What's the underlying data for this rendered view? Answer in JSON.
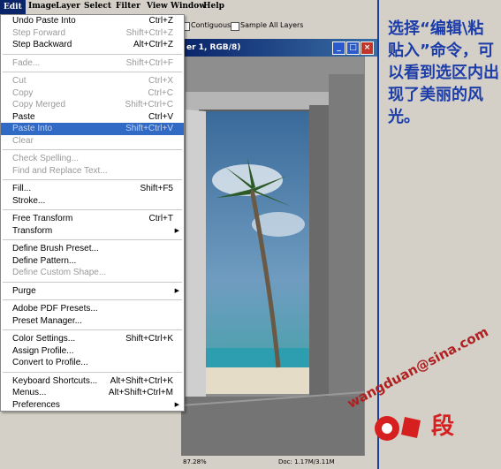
{
  "menubar": {
    "items": [
      "Edit",
      "Image",
      "Layer",
      "Select",
      "Filter",
      "View",
      "Window",
      "Help"
    ]
  },
  "options": {
    "contiguous": "Contiguous",
    "sample_all": "Sample All Layers"
  },
  "document": {
    "title": "er 1, RGB/8)",
    "zoom": "87.28%",
    "doc_info": "Doc: 1.17M/3.11M"
  },
  "edit_menu": {
    "items": [
      {
        "label": "Undo Paste Into",
        "shortcut": "Ctrl+Z"
      },
      {
        "label": "Step Forward",
        "shortcut": "Shift+Ctrl+Z",
        "disabled": true
      },
      {
        "label": "Step Backward",
        "shortcut": "Alt+Ctrl+Z"
      },
      {
        "label": "Fade...",
        "shortcut": "Shift+Ctrl+F",
        "disabled": true
      },
      {
        "label": "Cut",
        "shortcut": "Ctrl+X",
        "disabled": true
      },
      {
        "label": "Copy",
        "shortcut": "Ctrl+C",
        "disabled": true
      },
      {
        "label": "Copy Merged",
        "shortcut": "Shift+Ctrl+C",
        "disabled": true
      },
      {
        "label": "Paste",
        "shortcut": "Ctrl+V"
      },
      {
        "label": "Paste Into",
        "shortcut": "Shift+Ctrl+V",
        "disabled": true,
        "highlighted": true
      },
      {
        "label": "Clear",
        "shortcut": "",
        "disabled": true
      },
      {
        "label": "Check Spelling...",
        "shortcut": "",
        "disabled": true
      },
      {
        "label": "Find and Replace Text...",
        "shortcut": "",
        "disabled": true
      },
      {
        "label": "Fill...",
        "shortcut": "Shift+F5"
      },
      {
        "label": "Stroke...",
        "shortcut": ""
      },
      {
        "label": "Free Transform",
        "shortcut": "Ctrl+T"
      },
      {
        "label": "Transform",
        "shortcut": "",
        "submenu": true
      },
      {
        "label": "Define Brush Preset...",
        "shortcut": ""
      },
      {
        "label": "Define Pattern...",
        "shortcut": ""
      },
      {
        "label": "Define Custom Shape...",
        "shortcut": "",
        "disabled": true
      },
      {
        "label": "Purge",
        "shortcut": "",
        "submenu": true
      },
      {
        "label": "Adobe PDF Presets...",
        "shortcut": ""
      },
      {
        "label": "Preset Manager...",
        "shortcut": ""
      },
      {
        "label": "Color Settings...",
        "shortcut": "Shift+Ctrl+K"
      },
      {
        "label": "Assign Profile...",
        "shortcut": ""
      },
      {
        "label": "Convert to Profile...",
        "shortcut": ""
      },
      {
        "label": "Keyboard Shortcuts...",
        "shortcut": "Alt+Shift+Ctrl+K"
      },
      {
        "label": "Menus...",
        "shortcut": "Alt+Shift+Ctrl+M"
      },
      {
        "label": "Preferences",
        "shortcut": "",
        "submenu": true
      }
    ]
  },
  "annotation": {
    "text": "选择“编辑\\粘贴入”命令，可以看到选区内出现了美丽的风光。"
  },
  "watermark": {
    "email": "wangduan@sina.com",
    "logo_text": "段"
  },
  "colors": {
    "accent": "#1c3da8",
    "highlight": "#316ac5",
    "title": "#0a246a"
  }
}
